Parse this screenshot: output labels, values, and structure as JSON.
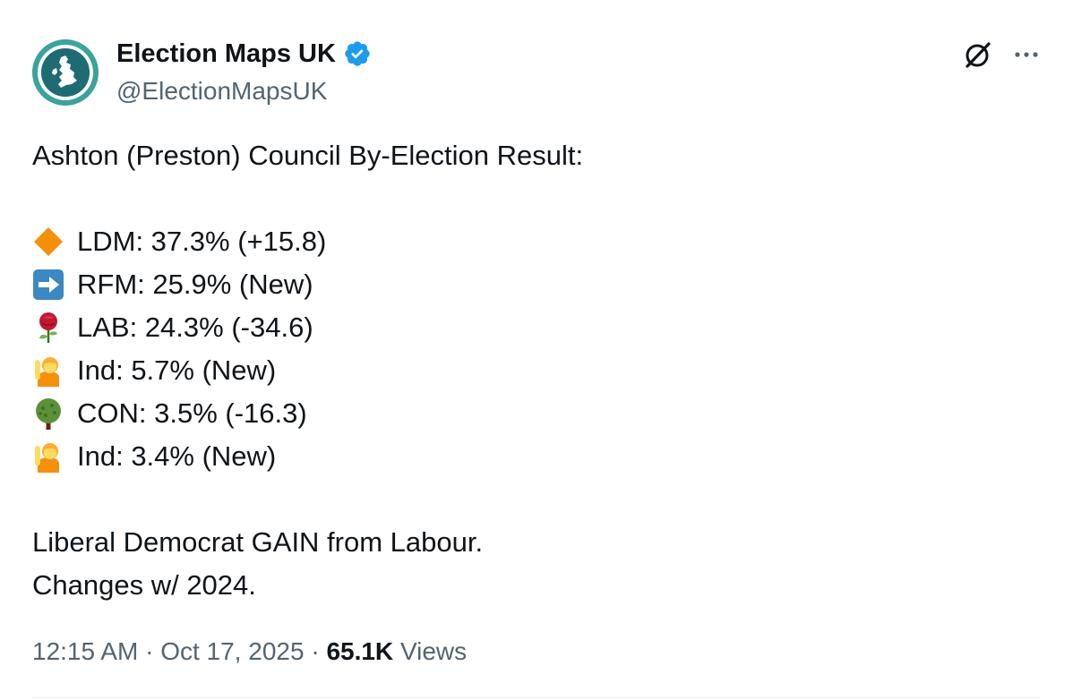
{
  "author": {
    "display_name": "Election Maps UK",
    "handle": "@ElectionMapsUK",
    "verified": true,
    "avatar_icon": "uk-map-globe-icon",
    "avatar_ring_color": "#3aa39a",
    "verified_color": "#1d9bf0"
  },
  "actions": {
    "grok_icon": "grok-icon",
    "more_icon": "more-horizontal-icon"
  },
  "tweet": {
    "title": "Ashton (Preston) Council By-Election Result:",
    "results": [
      {
        "icon": "orange-diamond-icon",
        "text": "LDM: 37.3% (+15.8)"
      },
      {
        "icon": "right-arrow-icon",
        "text": "RFM: 25.9% (New)"
      },
      {
        "icon": "rose-icon",
        "text": "LAB: 24.3% (-34.6)"
      },
      {
        "icon": "person-raising-hand-icon",
        "text": "Ind: 5.7% (New)"
      },
      {
        "icon": "tree-icon",
        "text": "CON: 3.5% (-16.3)"
      },
      {
        "icon": "person-raising-hand-icon",
        "text": "Ind: 3.4% (New)"
      }
    ],
    "summary_line_1": "Liberal Democrat GAIN from Labour.",
    "summary_line_2": "Changes w/ 2024."
  },
  "meta": {
    "time": "12:15 AM",
    "separator": "·",
    "date": "Oct 17, 2025",
    "views_count": "65.1K",
    "views_label": "Views"
  }
}
